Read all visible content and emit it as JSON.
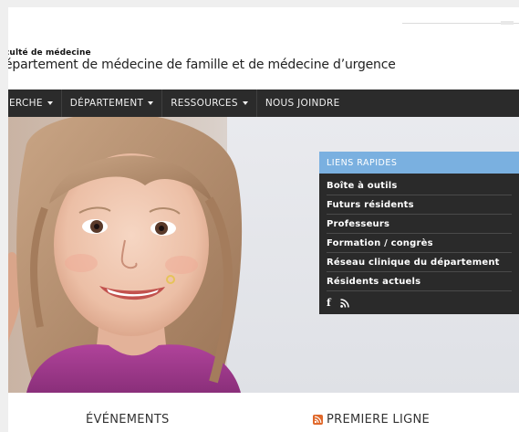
{
  "header": {
    "faculty": "culté de médecine",
    "department": "épartement de médecine de famille et de médecine d’urgence"
  },
  "nav": {
    "items": [
      {
        "label": "ERCHE",
        "dropdown": true
      },
      {
        "label": "DÉPARTEMENT",
        "dropdown": true
      },
      {
        "label": "RESSOURCES",
        "dropdown": true
      },
      {
        "label": "NOUS JOINDRE",
        "dropdown": false
      }
    ]
  },
  "quick_links": {
    "title": "LIENS RAPIDES",
    "items": [
      {
        "label": "Boîte à outils"
      },
      {
        "label": "Futurs résidents"
      },
      {
        "label": "Professeurs"
      },
      {
        "label": "Formation / congrès"
      },
      {
        "label": "Réseau clinique du département"
      },
      {
        "label": "Résidents actuels"
      }
    ],
    "icons": [
      "facebook-icon",
      "rss-icon"
    ]
  },
  "sections": {
    "events": "ÉVÉNEMENTS",
    "premiere": "PREMIERE LIGNE"
  },
  "colors": {
    "nav_bg": "#2b2b2b",
    "quick_header": "#7ab0e0",
    "quick_bg": "#2a2a2a",
    "rss": "#e0682a"
  }
}
